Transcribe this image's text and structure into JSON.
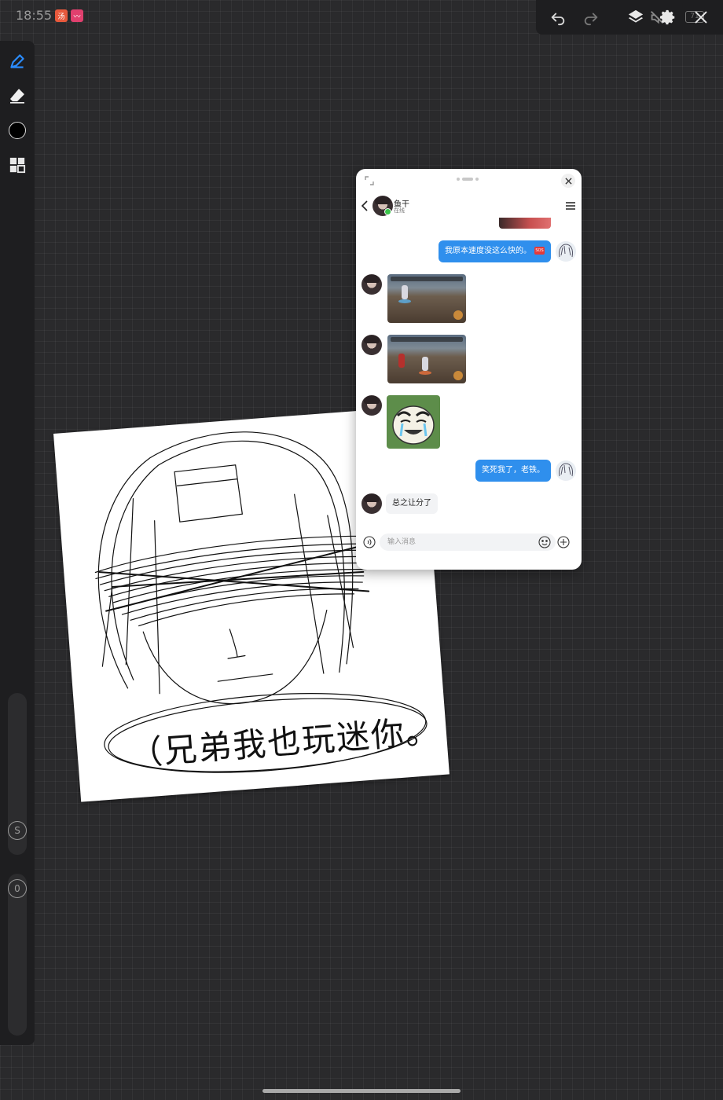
{
  "status_bar": {
    "time": "18:55",
    "badges": [
      {
        "name": "app-badge-orange",
        "text": "汤",
        "color": "#e8593c"
      },
      {
        "name": "app-badge-pink",
        "text": "〰",
        "color": "#e0406e"
      }
    ],
    "battery_text": "71"
  },
  "canvas_toolbar": {
    "tools": [
      "pen-icon",
      "eraser-icon",
      "color-picker",
      "layout-grid-icon"
    ],
    "active_color": "#000000",
    "accent_color": "#2b8cff",
    "brush_size_label": "S",
    "opacity_label": "0"
  },
  "drawing": {
    "caption": "（兄弟我也玩迷你。"
  },
  "chat": {
    "contact_name": "鱼干",
    "contact_status": "在线",
    "messages": [
      {
        "side": "out",
        "type": "text",
        "text": "我原本速度没这么快的。",
        "sticker": "SOS"
      },
      {
        "side": "in",
        "type": "image",
        "description": "game-screenshot"
      },
      {
        "side": "in",
        "type": "image",
        "description": "game-screenshot"
      },
      {
        "side": "in",
        "type": "sticker",
        "description": "crying-laughing-sticker"
      },
      {
        "side": "out",
        "type": "text",
        "text": "笑死我了，老铁。"
      },
      {
        "side": "in",
        "type": "text",
        "text": "总之让分了"
      }
    ],
    "input_placeholder": "输入消息",
    "bubble_color": "#2f8fed"
  }
}
